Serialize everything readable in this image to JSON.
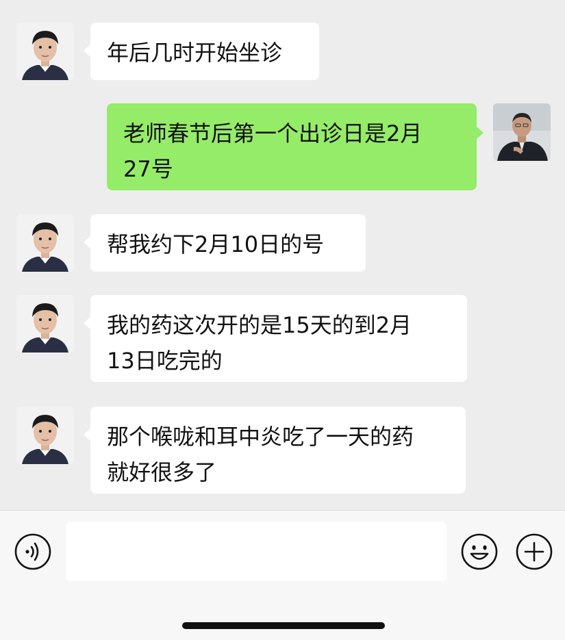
{
  "messages": [
    {
      "side": "in",
      "avatar": "boy-avatar",
      "lines": [
        "年后几时开始坐诊"
      ]
    },
    {
      "side": "out",
      "avatar": "doctor-avatar",
      "lines": [
        "老师春节后第一个出诊日是2月",
        "27号"
      ]
    },
    {
      "side": "in",
      "avatar": "boy-avatar",
      "lines": [
        "帮我约下2月10日的号"
      ]
    },
    {
      "side": "in",
      "avatar": "boy-avatar",
      "lines": [
        "我的药这次开的是15天的到2月",
        "13日吃完的"
      ]
    },
    {
      "side": "in",
      "avatar": "boy-avatar",
      "lines": [
        "那个喉咙和耳中炎吃了一天的药",
        "就好很多了"
      ]
    }
  ],
  "composer": {
    "input_value": "",
    "voice_icon": "voice-icon",
    "emoji_icon": "emoji-icon",
    "more_icon": "plus-icon"
  },
  "colors": {
    "background": "#ededed",
    "incoming_bubble": "#ffffff",
    "outgoing_bubble": "#95ec69",
    "composer_bg": "#f7f7f7"
  }
}
